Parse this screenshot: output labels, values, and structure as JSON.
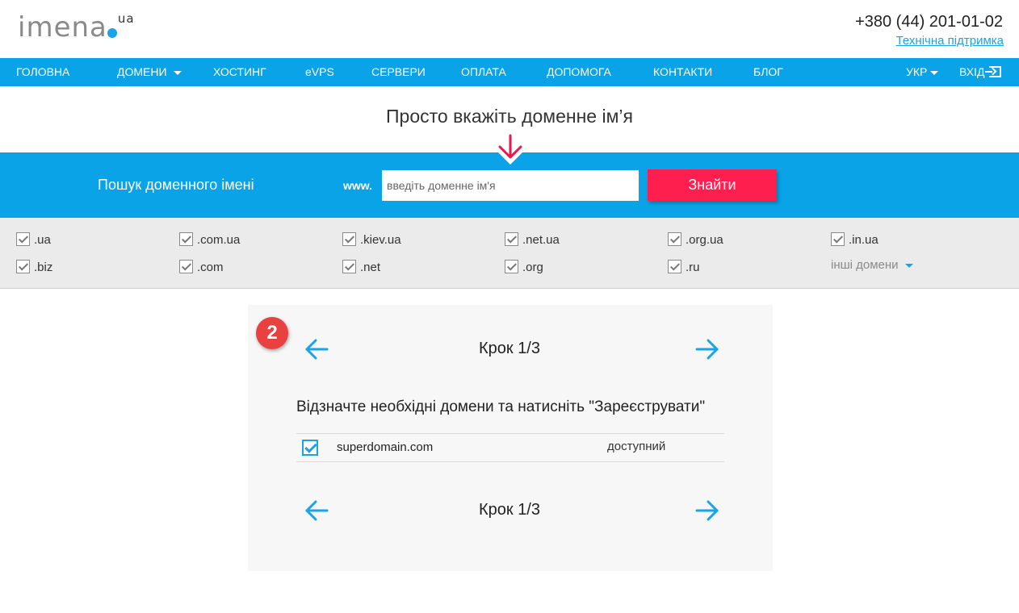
{
  "header": {
    "logo_name": "imena",
    "logo_tld": "ua",
    "phone": "+380 (44) 201-01-02",
    "support_link": "Технічна підтримка"
  },
  "nav": {
    "items": [
      {
        "label": "ГОЛОВНА"
      },
      {
        "label": "ДОМЕНИ"
      },
      {
        "label": "ХОСТИНГ"
      },
      {
        "label": "eVPS"
      },
      {
        "label": "СЕРВЕРИ"
      },
      {
        "label": "ОПЛАТА"
      },
      {
        "label": "ДОПОМОГА"
      },
      {
        "label": "КОНТАКТИ"
      },
      {
        "label": "БЛОГ"
      }
    ],
    "language": "УКР",
    "login": "ВХІД"
  },
  "headline": "Просто вкажіть доменне ім’я",
  "search": {
    "label": "Пошук доменного імені",
    "prefix": "www.",
    "placeholder": "введіть доменне ім'я",
    "button": "Знайти"
  },
  "tlds": {
    "row1": [
      ".ua",
      ".com.ua",
      ".kiev.ua",
      ".net.ua",
      ".org.ua",
      ".in.ua"
    ],
    "row2": [
      ".biz",
      ".com",
      ".net",
      ".org",
      ".ru"
    ],
    "other": "інші домени"
  },
  "panel": {
    "badge": "2",
    "step": "Крок 1/3",
    "instructions": "Відзначте необхідні домени та натисніть \"Зареєструвати\"",
    "results": [
      {
        "domain": "superdomain.com",
        "status": "доступний",
        "checked": true
      }
    ]
  },
  "colors": {
    "brand_blue": "#0aa3e8",
    "search_button": "#ff1f4f",
    "badge": "#e8413f"
  }
}
